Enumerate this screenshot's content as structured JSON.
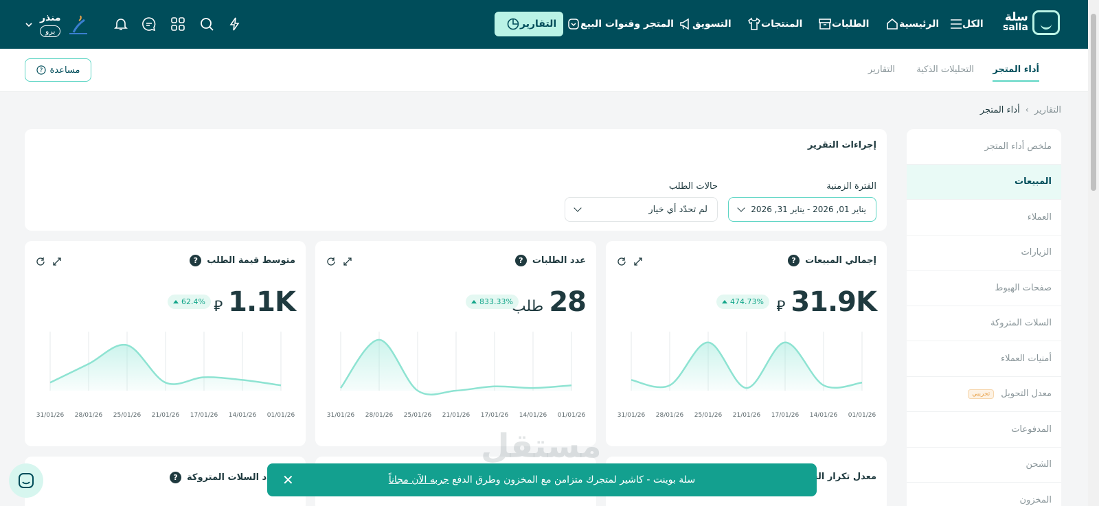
{
  "nav": {
    "logo_text": "سلة",
    "logo_sub": "salla",
    "items": [
      {
        "label": "الكل"
      },
      {
        "label": "الرئيسية"
      },
      {
        "label": "الطلبات"
      },
      {
        "label": "المنتجات"
      },
      {
        "label": "التسويق"
      },
      {
        "label": "المتجر وقنوات البيع"
      },
      {
        "label": "التقارير"
      }
    ],
    "user_name": "منذر",
    "user_plan": "برو"
  },
  "subnav": {
    "tabs": [
      {
        "label": "أداء المتجر"
      },
      {
        "label": "التحليلات الذكية"
      },
      {
        "label": "التقارير"
      }
    ],
    "help_label": "مساعدة"
  },
  "breadcrumb": {
    "root": "التقارير",
    "current": "أداء المتجر"
  },
  "sidebar": {
    "items": [
      {
        "label": "ملخص أداء المتجر"
      },
      {
        "label": "المبيعات"
      },
      {
        "label": "العملاء"
      },
      {
        "label": "الزيارات"
      },
      {
        "label": "صفحات الهبوط"
      },
      {
        "label": "السلات المتروكة"
      },
      {
        "label": "أمنيات العملاء"
      },
      {
        "label": "معدل التحويل",
        "badge": "تجريبي"
      },
      {
        "label": "المدفوعات"
      },
      {
        "label": "الشحن"
      },
      {
        "label": "المخزون"
      }
    ]
  },
  "actions": {
    "title": "إجراءات التقرير",
    "period_label": "الفترة الزمنية",
    "period_value": "يناير 01, 2026   -   يناير 31, 2026",
    "status_label": "حالات الطلب",
    "status_placeholder": "لم تحدّد أي خيار"
  },
  "cards": [
    {
      "title": "إجمالي المبيعات",
      "value": "31.9K",
      "unit": "⃁",
      "change": "474.73%"
    },
    {
      "title": "عدد الطلبات",
      "value": "28",
      "unit": "طلب",
      "change": "833.33%"
    },
    {
      "title": "متوسط قيمة الطلب",
      "value": "1.1K",
      "unit": "⃁",
      "change": "62.4%"
    }
  ],
  "bottom_cards": [
    {
      "title": "معدل تكرار الشراء"
    },
    {
      "title": "استرداد السلات المتروكة"
    }
  ],
  "chart_data": [
    {
      "type": "area",
      "x": [
        "01/01/26",
        "14/01/26",
        "17/01/26",
        "21/01/26",
        "25/01/26",
        "28/01/26",
        "31/01/26"
      ],
      "values": [
        0.15,
        0.1,
        0.9,
        0.05,
        0.9,
        0.1,
        0.2
      ]
    },
    {
      "type": "area",
      "x": [
        "01/01/26",
        "14/01/26",
        "17/01/26",
        "21/01/26",
        "25/01/26",
        "28/01/26",
        "31/01/26"
      ],
      "values": [
        0.1,
        0.05,
        0.08,
        0.0,
        0.0,
        0.95,
        0.05
      ]
    },
    {
      "type": "area",
      "x": [
        "01/01/26",
        "14/01/26",
        "17/01/26",
        "21/01/26",
        "25/01/26",
        "28/01/26",
        "31/01/26"
      ],
      "values": [
        0.1,
        0.2,
        0.25,
        0.15,
        0.85,
        0.5,
        0.15
      ]
    }
  ],
  "toast": {
    "text": "سلة بوينت - كاشير لمتجرك متزامن مع المخزون وطرق الدفع",
    "link": "جربه الآن مجاناً"
  },
  "watermark": "مستقل"
}
